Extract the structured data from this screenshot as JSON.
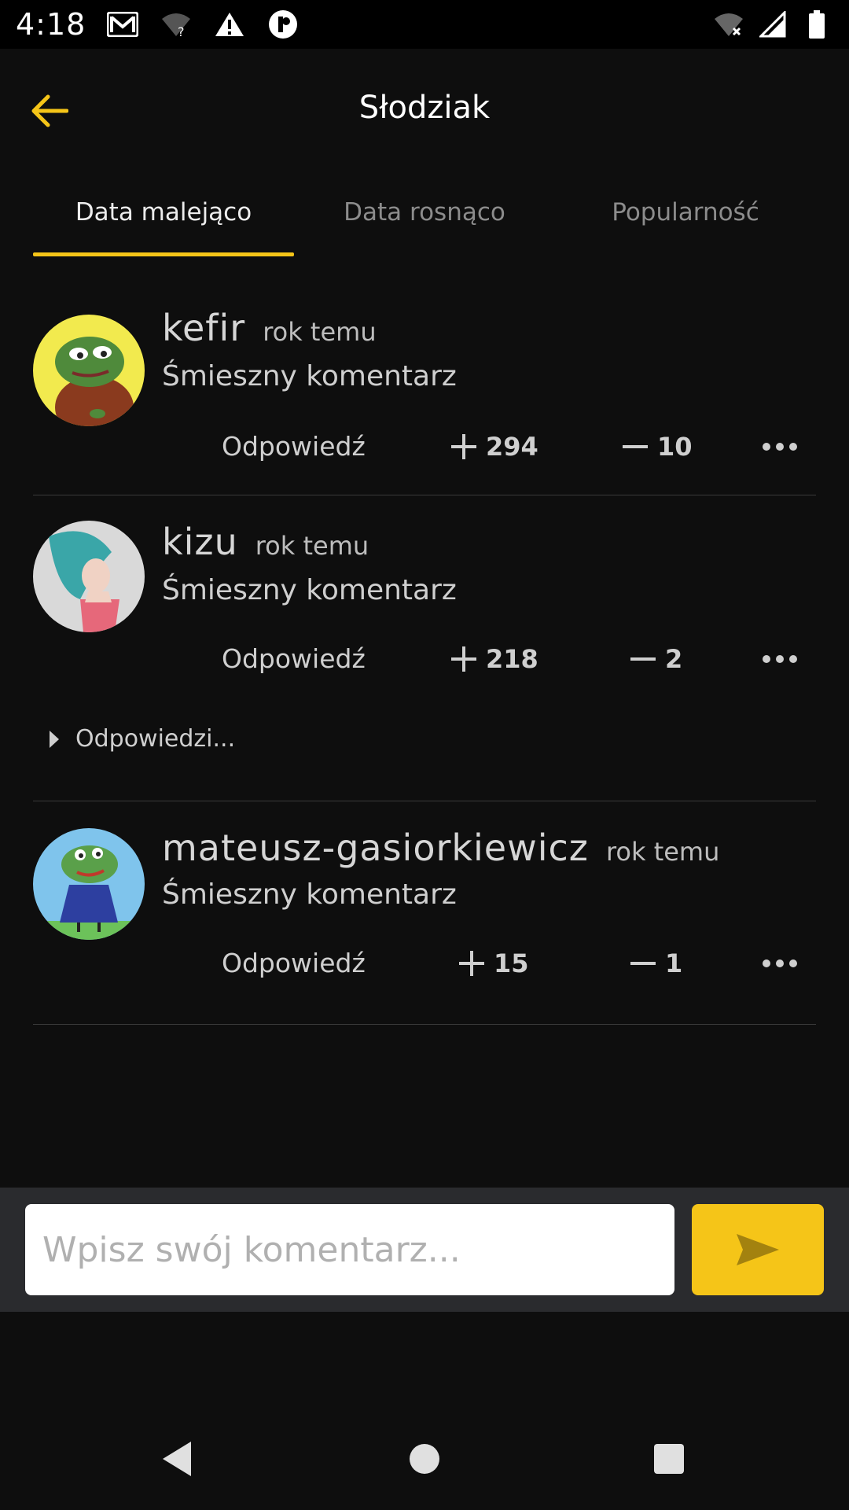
{
  "status_bar": {
    "time": "4:18",
    "left_icons": [
      "gmail-icon",
      "wifi-question-icon",
      "warning-icon",
      "app-notification-icon"
    ],
    "right_icons": [
      "wifi-off-icon",
      "signal-icon",
      "battery-icon"
    ]
  },
  "app_bar": {
    "title": "Słodziak",
    "accent_color": "#f5c518"
  },
  "tabs": [
    {
      "label": "Data malejąco",
      "active": true
    },
    {
      "label": "Data rosnąco",
      "active": false
    },
    {
      "label": "Popularność",
      "active": false
    }
  ],
  "comments": [
    {
      "author": "kefir",
      "time": "rok temu",
      "text": "Śmieszny komentarz",
      "reply_label": "Odpowiedź",
      "upvotes": "294",
      "downvotes": "10",
      "avatar": "pepe-frog-avatar"
    },
    {
      "author": "kizu",
      "time": "rok temu",
      "text": "Śmieszny komentarz",
      "reply_label": "Odpowiedź",
      "upvotes": "218",
      "downvotes": "2",
      "avatar": "anime-girl-avatar",
      "replies_toggle": "Odpowiedzi..."
    },
    {
      "author": "mateusz-gasiorkiewicz",
      "time": "rok temu",
      "text": "Śmieszny komentarz",
      "reply_label": "Odpowiedź",
      "upvotes": "15",
      "downvotes": "1",
      "avatar": "peppa-pepe-avatar"
    }
  ],
  "composer": {
    "placeholder": "Wpisz swój komentarz...",
    "value": "",
    "send_icon": "send-icon"
  },
  "nav": [
    "back-nav-icon",
    "home-nav-icon",
    "recents-nav-icon"
  ]
}
